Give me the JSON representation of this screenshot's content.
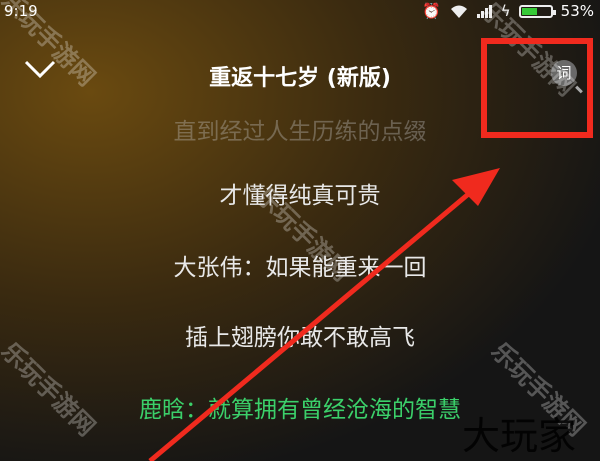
{
  "status_bar": {
    "time": "9:19",
    "battery_percent": "53%",
    "battery_level": 0.53
  },
  "header": {
    "title": "重返十七岁 (新版)",
    "lyrics_button_label": "词"
  },
  "lyrics": {
    "faded_line": "直到经过人生历练的点缀",
    "line_2": "才懂得纯真可贵",
    "line_3": "大张伟：如果能重来一回",
    "line_4": "插上翅膀你敢不敢高飞",
    "current_line": "鹿晗：就算拥有曾经沧海的智慧"
  },
  "watermarks": {
    "site_text": "乐玩手游网",
    "brand_text": "大玩家"
  },
  "colors": {
    "current_lyric": "#3bd06a",
    "annotation": "#f02a1e",
    "battery": "#36c936"
  }
}
